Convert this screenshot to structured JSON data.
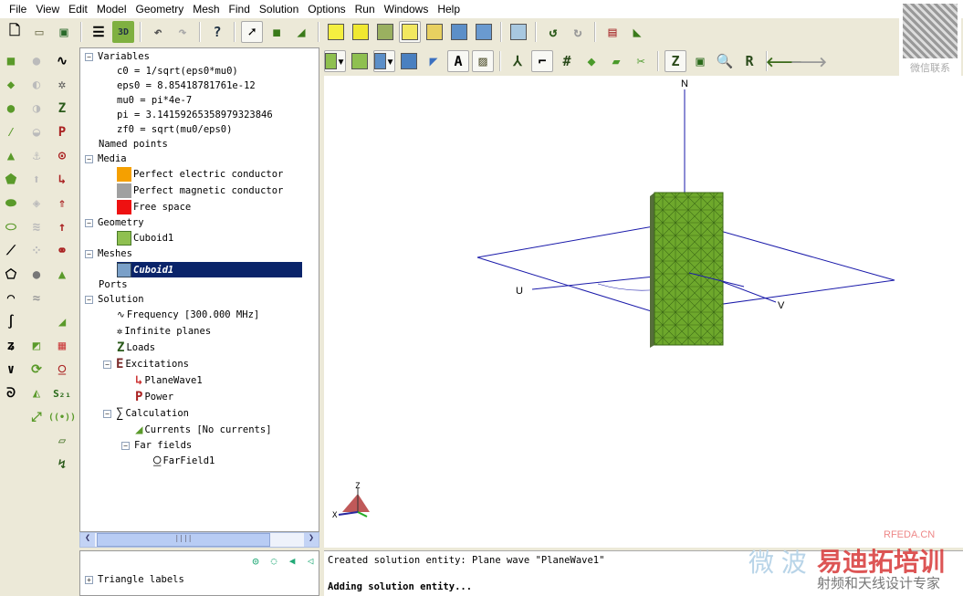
{
  "menu": [
    "File",
    "View",
    "Edit",
    "Model",
    "Geometry",
    "Mesh",
    "Find",
    "Solution",
    "Options",
    "Run",
    "Windows",
    "Help"
  ],
  "toolbar_labels": {
    "view3d": "3D",
    "text": "A",
    "lockz": "Z",
    "rot": "R"
  },
  "tree": {
    "variables": "Variables",
    "vars": [
      "c0 = 1/sqrt(eps0*mu0)",
      "eps0 = 8.85418781761e-12",
      "mu0 = pi*4e-7",
      "pi = 3.14159265358979323846",
      "zf0 = sqrt(mu0/eps0)"
    ],
    "named_points": "Named points",
    "media": "Media",
    "media_items": [
      {
        "label": "Perfect electric conductor",
        "color": "#f5a000"
      },
      {
        "label": "Perfect magnetic conductor",
        "color": "#a0a0a0"
      },
      {
        "label": "Free space",
        "color": "#ee1111"
      }
    ],
    "geometry": "Geometry",
    "geometry_item": "Cuboid1",
    "meshes": "Meshes",
    "mesh_item": "Cuboid1",
    "ports": "Ports",
    "solution": "Solution",
    "frequency": "Frequency [300.000 MHz]",
    "infinite_planes": "Infinite planes",
    "loads": "Loads",
    "excitations": "Excitations",
    "planewave": "PlaneWave1",
    "power": "Power",
    "calculation": "Calculation",
    "currents": "Currents [No currents]",
    "far_fields": "Far fields",
    "farfield": "FarField1"
  },
  "lower": {
    "triangle_labels": "Triangle labels"
  },
  "view": {
    "axis_n": "N",
    "axis_u": "U",
    "axis_v": "V",
    "triad_z": "Z",
    "triad_x": "X"
  },
  "output": [
    "Created solution entity: Plane wave \"PlaneWave1\"",
    "Adding solution entity..."
  ],
  "qr_caption": "微信联系",
  "watermark": {
    "site": "RFEDA.CN",
    "brand": "易迪拓培训",
    "slogan": "射频和天线设计专家",
    "left": "微 波"
  },
  "colors": {
    "accent": "#0a246a",
    "mesh": "#6ea82c"
  }
}
